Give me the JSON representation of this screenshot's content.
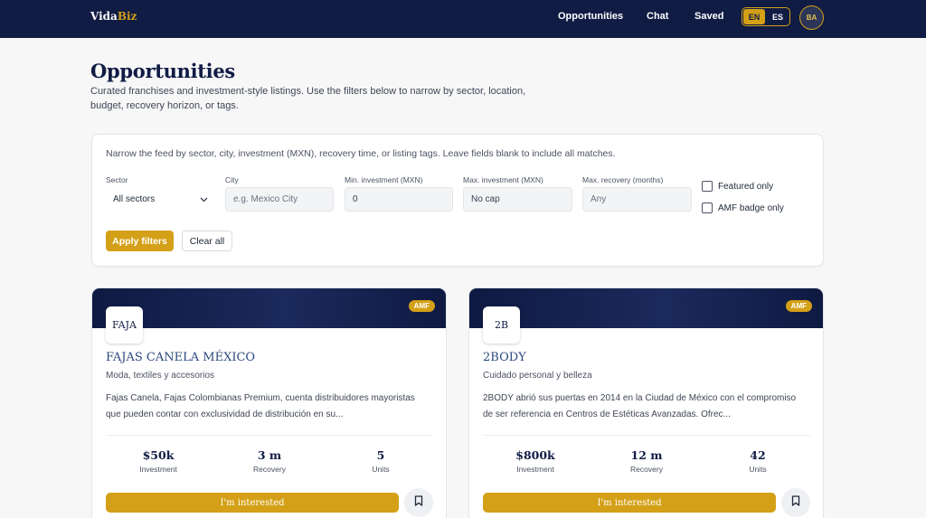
{
  "nav": {
    "brand_main": "Vida",
    "brand_accent": "Biz",
    "links": [
      "Opportunities",
      "Chat",
      "Saved"
    ],
    "lang_active": "EN",
    "lang_other": "ES",
    "avatar": "BA"
  },
  "header": {
    "title": "Opportunities",
    "subtitle": "Curated franchises and investment-style listings. Use the filters below to narrow by sector, location, budget, recovery horizon, or tags."
  },
  "filters": {
    "note": "Narrow the feed by sector, city, investment (MXN), recovery time, or listing tags. Leave fields blank to include all matches.",
    "sector_label": "Sector",
    "sector_value": "All sectors",
    "city_label": "City",
    "city_placeholder": "e.g. Mexico City",
    "min_label": "Min. investment (MXN)",
    "min_value": "0",
    "max_label": "Max. investment (MXN)",
    "max_value": "No cap",
    "recovery_label": "Max. recovery (months)",
    "recovery_value": "Any",
    "featured_label": "Featured only",
    "amf_label": "AMF badge only",
    "apply_label": "Apply filters",
    "clear_label": "Clear all"
  },
  "cards": [
    {
      "badge": "AMF",
      "logo": "FAJA",
      "name": "FAJAS CANELA MÉXICO",
      "category": "Moda, textiles y accesorios",
      "description": "Fajas Canela, Fajas Colombianas Premium, cuenta distribuidores mayoristas que pueden contar con exclusividad de distribución en su...",
      "stats": [
        {
          "value": "$50k",
          "label": "Investment"
        },
        {
          "value": "3 m",
          "label": "Recovery"
        },
        {
          "value": "5",
          "label": "Units"
        }
      ],
      "cta": "I'm interested"
    },
    {
      "badge": "AMF",
      "logo": "2B",
      "name": "2BODY",
      "category": "Cuidado personal y belleza",
      "description": "2BODY abrió sus puertas en 2014 en la Ciudad de México con el compromiso de ser referencia en Centros de Estéticas Avanzadas. Ofrec...",
      "stats": [
        {
          "value": "$800k",
          "label": "Investment"
        },
        {
          "value": "12 m",
          "label": "Recovery"
        },
        {
          "value": "42",
          "label": "Units"
        }
      ],
      "cta": "I'm interested"
    }
  ],
  "icons": {
    "chevron": "chevron-down-icon",
    "save": "bookmark-icon"
  },
  "colors": {
    "navy": "#101c44",
    "gold": "#d4a017"
  }
}
